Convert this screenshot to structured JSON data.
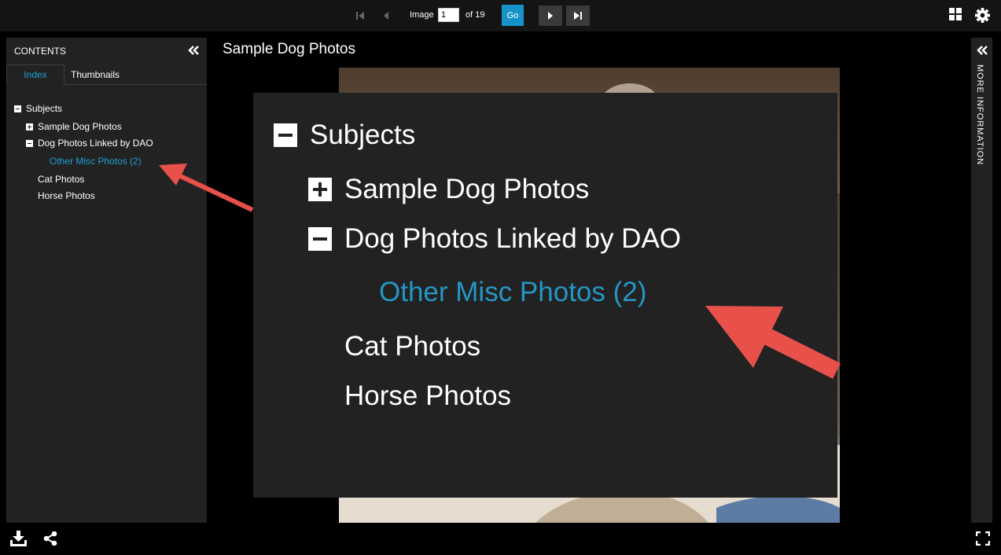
{
  "toolbar": {
    "image_label": "Image",
    "image_value": "1",
    "of_label": "of 19",
    "go_label": "Go",
    "icons": [
      "first-page-icon",
      "prev-page-icon",
      "next-page-icon",
      "last-page-icon",
      "grid-view-icon",
      "gear-icon"
    ]
  },
  "contents_panel": {
    "title": "CONTENTS",
    "tabs": [
      {
        "label": "Index",
        "active": true
      },
      {
        "label": "Thumbnails",
        "active": false
      }
    ],
    "tree": [
      {
        "label": "Subjects",
        "toggle": "minus"
      },
      {
        "label": "Sample Dog Photos",
        "toggle": "plus"
      },
      {
        "label": "Dog Photos Linked by DAO",
        "toggle": "minus"
      },
      {
        "label": "Other Misc Photos (2)",
        "selected": true
      },
      {
        "label": "Cat Photos"
      },
      {
        "label": "Horse Photos"
      }
    ]
  },
  "main": {
    "title": "Sample Dog Photos"
  },
  "zoom_callout": {
    "items": [
      {
        "label": "Subjects"
      },
      {
        "label": "Sample Dog Photos"
      },
      {
        "label": "Dog Photos Linked by DAO"
      },
      {
        "label": "Other Misc Photos (2)"
      },
      {
        "label": "Cat Photos"
      },
      {
        "label": "Horse Photos"
      }
    ]
  },
  "info_panel": {
    "label": "MORE INFORMATION"
  },
  "footer": {
    "icons": [
      "download-icon",
      "share-icon",
      "fullscreen-icon"
    ]
  },
  "colors": {
    "accent": "#1da0d6",
    "go_button": "#1593c9",
    "annotation_arrow": "#e8504a",
    "panel_bg": "#222222"
  }
}
